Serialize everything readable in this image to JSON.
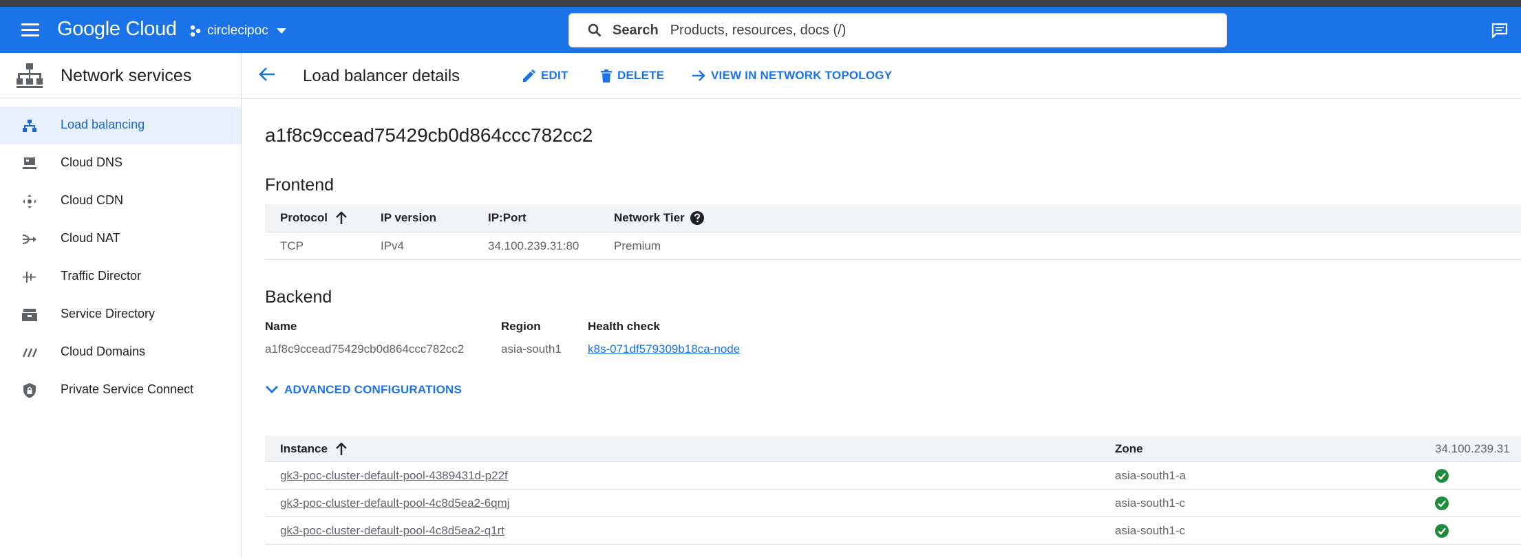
{
  "header": {
    "logo": "Google Cloud",
    "project": "circlecipoc",
    "search_label": "Search",
    "search_placeholder": "Products, resources, docs (/)"
  },
  "sidebar": {
    "title": "Network services",
    "items": [
      {
        "label": "Load balancing",
        "icon": "load-balancing-icon",
        "active": true
      },
      {
        "label": "Cloud DNS",
        "icon": "dns-icon"
      },
      {
        "label": "Cloud CDN",
        "icon": "cdn-icon"
      },
      {
        "label": "Cloud NAT",
        "icon": "nat-icon"
      },
      {
        "label": "Traffic Director",
        "icon": "traffic-director-icon"
      },
      {
        "label": "Service Directory",
        "icon": "service-directory-icon"
      },
      {
        "label": "Cloud Domains",
        "icon": "domains-icon"
      },
      {
        "label": "Private Service Connect",
        "icon": "shield-lock-icon"
      }
    ]
  },
  "actionbar": {
    "title": "Load balancer details",
    "edit": "EDIT",
    "delete": "DELETE",
    "topology": "VIEW IN NETWORK TOPOLOGY"
  },
  "lb_name": "a1f8c9ccead75429cb0d864ccc782cc2",
  "frontend": {
    "heading": "Frontend",
    "headers": [
      "Protocol",
      "IP version",
      "IP:Port",
      "Network Tier"
    ],
    "rows": [
      [
        "TCP",
        "IPv4",
        "34.100.239.31:80",
        "Premium"
      ]
    ]
  },
  "backend": {
    "heading": "Backend",
    "name_label": "Name",
    "name_value": "a1f8c9ccead75429cb0d864ccc782cc2",
    "region_label": "Region",
    "region_value": "asia-south1",
    "health_label": "Health check",
    "health_value": "k8s-071df579309b18ca-node"
  },
  "advanced": "ADVANCED CONFIGURATIONS",
  "instances": {
    "headers": [
      "Instance",
      "Zone",
      "34.100.239.31"
    ],
    "rows": [
      {
        "name": "gk3-poc-cluster-default-pool-4389431d-p22f",
        "zone": "asia-south1-a",
        "status": "healthy"
      },
      {
        "name": "gk3-poc-cluster-default-pool-4c8d5ea2-6qmj",
        "zone": "asia-south1-c",
        "status": "healthy"
      },
      {
        "name": "gk3-poc-cluster-default-pool-4c8d5ea2-q1rt",
        "zone": "asia-south1-c",
        "status": "healthy"
      }
    ]
  },
  "colors": {
    "brand": "#1a73e8",
    "healthy": "#1e8e3e"
  }
}
